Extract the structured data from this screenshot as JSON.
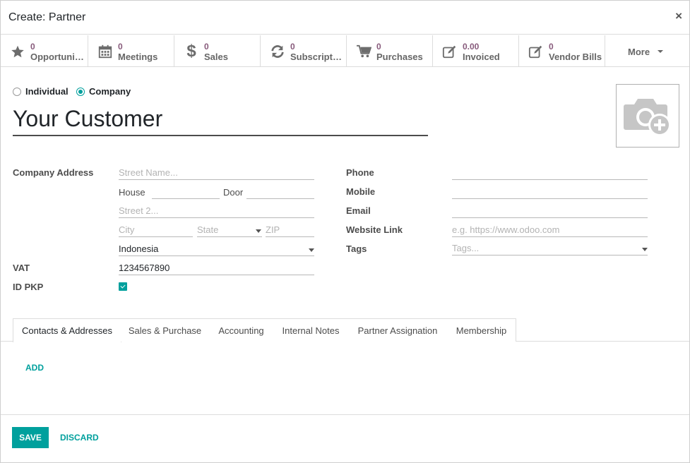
{
  "dialog": {
    "title": "Create: Partner",
    "close_symbol": "×"
  },
  "stats": [
    {
      "count": "0",
      "label": "Opportunities",
      "icon": "star-icon"
    },
    {
      "count": "0",
      "label": "Meetings",
      "icon": "calendar-icon"
    },
    {
      "count": "0",
      "label": "Sales",
      "icon": "dollar-icon"
    },
    {
      "count": "0",
      "label": "Subscriptions",
      "icon": "refresh-icon"
    },
    {
      "count": "0",
      "label": "Purchases",
      "icon": "cart-icon"
    },
    {
      "count": "0.00",
      "label": "Invoiced",
      "icon": "edit-icon"
    },
    {
      "count": "0",
      "label": "Vendor Bills",
      "icon": "edit-icon"
    }
  ],
  "more_label": "More",
  "company_type": {
    "individual": "Individual",
    "company": "Company",
    "selected": "company"
  },
  "partner_name": "Your Customer",
  "address": {
    "label": "Company Address",
    "street_placeholder": "Street Name...",
    "house_label": "House",
    "door_label": "Door",
    "street2_placeholder": "Street 2...",
    "city_placeholder": "City",
    "state_placeholder": "State",
    "zip_placeholder": "ZIP",
    "country": "Indonesia"
  },
  "vat": {
    "label": "VAT",
    "value": "1234567890"
  },
  "id_pkp": {
    "label": "ID PKP",
    "checked": true
  },
  "contact": {
    "phone_label": "Phone",
    "mobile_label": "Mobile",
    "email_label": "Email",
    "website_label": "Website Link",
    "website_placeholder": "e.g. https://www.odoo.com",
    "tags_label": "Tags",
    "tags_placeholder": "Tags..."
  },
  "tabs": [
    "Contacts & Addresses",
    "Sales & Purchase",
    "Accounting",
    "Internal Notes",
    "Partner Assignation",
    "Membership"
  ],
  "add_label": "ADD",
  "footer": {
    "save": "SAVE",
    "discard": "DISCARD"
  },
  "colors": {
    "accent": "#00a09d",
    "stat_number": "#875a7b"
  }
}
